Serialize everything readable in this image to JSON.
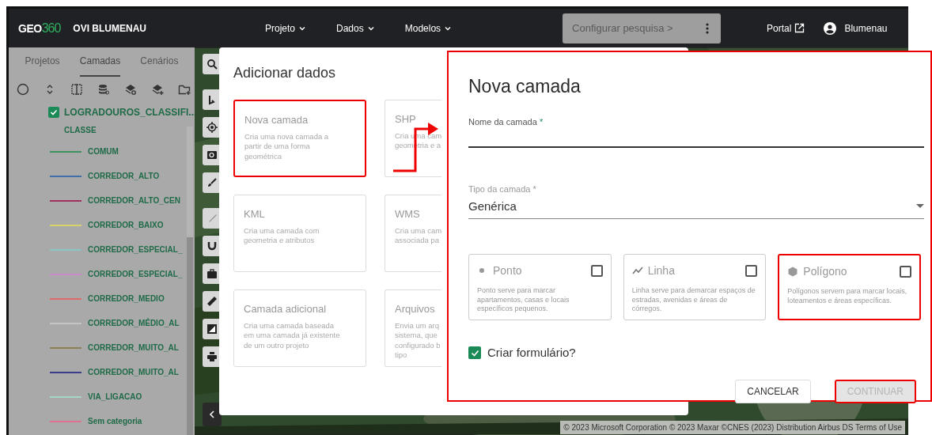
{
  "navbar": {
    "logo_prefix": "GEO",
    "logo_suffix": "360",
    "project": "OVI BLUMENAU",
    "menus": [
      {
        "label": "Projeto"
      },
      {
        "label": "Dados"
      },
      {
        "label": "Modelos"
      }
    ],
    "search": {
      "placeholder": "Configurar pesquisa >"
    },
    "portal": "Portal",
    "user": "Blumenau"
  },
  "sidebar": {
    "tabs": [
      {
        "label": "Projetos",
        "selected": false
      },
      {
        "label": "Camadas",
        "selected": true
      },
      {
        "label": "Cenários",
        "selected": false
      }
    ],
    "layer": {
      "name": "LOGRADOUROS_CLASSIFI...",
      "checked": true,
      "group": "CLASSE",
      "legend": [
        {
          "label": "COMUM",
          "color": "#3f8f5f"
        },
        {
          "label": "CORREDOR_ALTO",
          "color": "#3f6fa8"
        },
        {
          "label": "CORREDOR_ALTO_CEN",
          "color": "#a03060"
        },
        {
          "label": "CORREDOR_BAIXO",
          "color": "#d6d36a"
        },
        {
          "label": "CORREDOR_ESPECIAL_",
          "color": "#86c6c6"
        },
        {
          "label": "CORREDOR_ESPECIAL_",
          "color": "#c88ac8"
        },
        {
          "label": "CORREDOR_MEDIO",
          "color": "#e06a6a"
        },
        {
          "label": "CORREDOR_MÉDIO_AL",
          "color": "#c4c4c4"
        },
        {
          "label": "CORREDOR_MUITO_AL",
          "color": "#8d7f55"
        },
        {
          "label": "CORREDOR_MUITO_AL",
          "color": "#3c3c8c"
        },
        {
          "label": "VIA_LIGACAO",
          "color": "#a6d6c6"
        },
        {
          "label": "Sem categoria",
          "color": "#e07090"
        }
      ]
    }
  },
  "map": {
    "attribution": "© 2023 Microsoft Corporation © 2023 Maxar ©CNES (2023) Distribution Airbus DS Terms of Use"
  },
  "add_data_dialog": {
    "title": "Adicionar dados",
    "options": [
      {
        "title": "Nova camada",
        "description_lines": [
          "Cria uma nova camada a",
          "partir de uma forma",
          "geométrica"
        ],
        "highlighted": true
      },
      {
        "title": "SHP",
        "description_lines": [
          "Cria uma cam",
          "geometria e a"
        ],
        "highlighted": false
      },
      {
        "title": "KML",
        "description_lines": [
          "Cria uma camada com",
          "geometria e atributos"
        ],
        "highlighted": false
      },
      {
        "title": "WMS",
        "description_lines": [
          "Cria uma cam",
          "associada pa"
        ],
        "highlighted": false
      },
      {
        "title": "Camada adicional",
        "description_lines": [
          "Cria uma camada baseada",
          "em uma camada já existente",
          "de um outro projeto"
        ],
        "highlighted": false
      },
      {
        "title": "Arquivos",
        "description_lines": [
          "Envia um arq",
          "sistema, que",
          "configurado b",
          "tipo"
        ],
        "highlighted": false
      }
    ]
  },
  "new_layer_dialog": {
    "title": "Nova camada",
    "highlighted": true,
    "name_field": {
      "label": "Nome da camada",
      "required_mark": "*"
    },
    "type_field": {
      "label": "Tipo da camada *",
      "value": "Genérica"
    },
    "geometry_options": [
      {
        "kind": "point",
        "title": "Ponto",
        "description": "Ponto serve para marcar apartamentos, casas e locais específicos pequenos.",
        "checked": false,
        "highlighted": false
      },
      {
        "kind": "line",
        "title": "Linha",
        "description": "Linha serve para demarcar espaços de estradas, avenidas e áreas de córregos.",
        "checked": false,
        "highlighted": false
      },
      {
        "kind": "polygon",
        "title": "Polígono",
        "description": "Polígonos servem para marcar locais, loteamentos e áreas específicas.",
        "checked": false,
        "highlighted": true
      }
    ],
    "create_form": {
      "label": "Criar formulário?",
      "checked": true
    },
    "buttons": [
      {
        "label": "CANCELAR",
        "disabled": false,
        "highlighted": false
      },
      {
        "label": "CONTINUAR",
        "disabled": true,
        "highlighted": true
      }
    ]
  }
}
